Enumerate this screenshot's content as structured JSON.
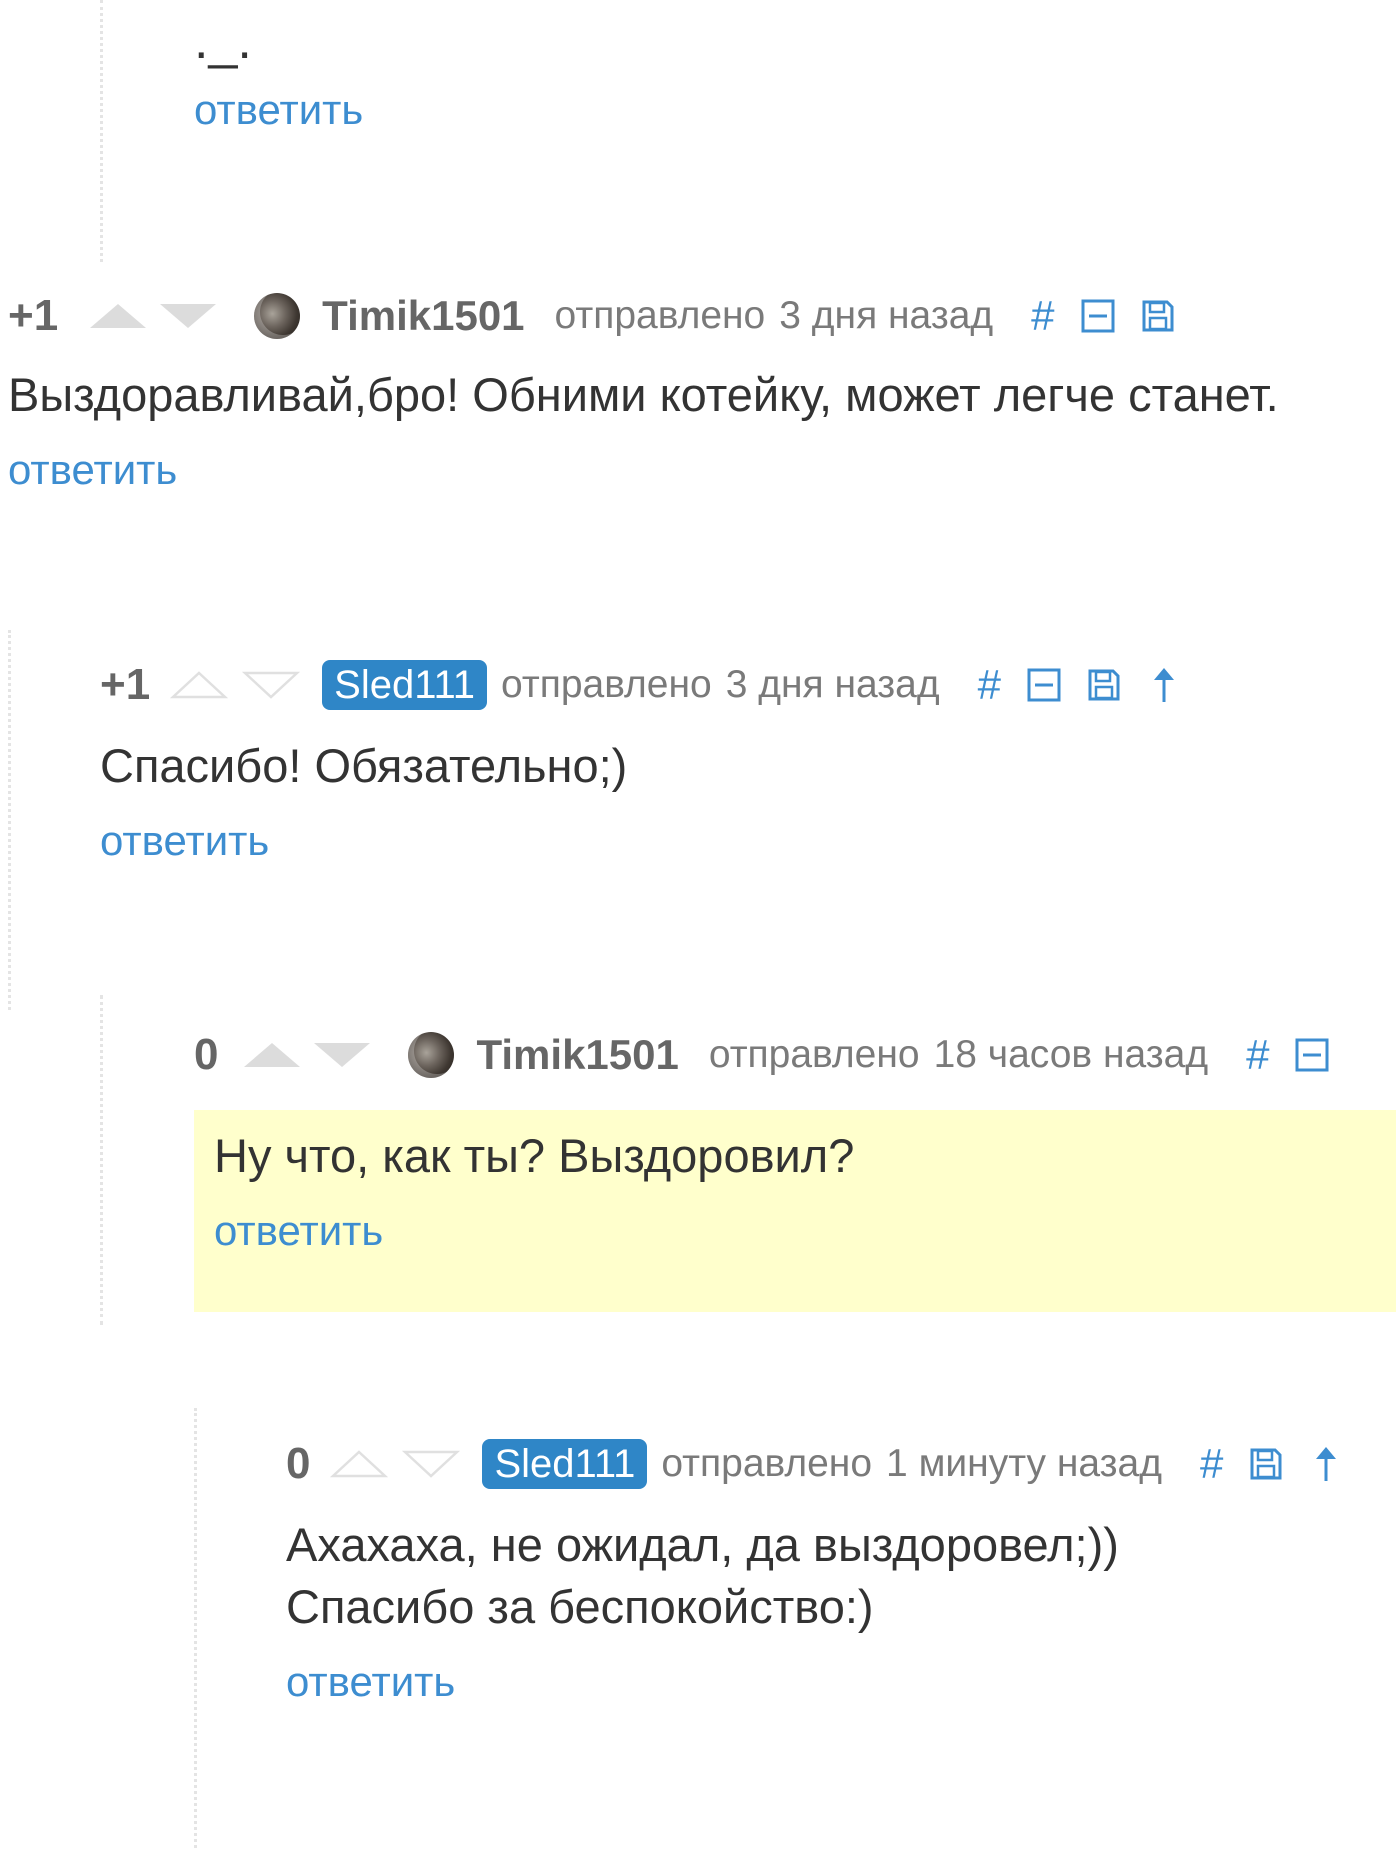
{
  "top_comment": {
    "body": "._.",
    "reply_label": "ответить"
  },
  "comments": [
    {
      "rating": "+1",
      "user": "Timik1501",
      "sent_label": "отправлено",
      "time": "3 дня назад",
      "hash": "#",
      "body": "Выздоравливай,бро! Обними котейку, может легче станет.",
      "reply_label": "ответить"
    },
    {
      "rating": "+1",
      "user": "Sled111",
      "sent_label": "отправлено",
      "time": "3 дня назад",
      "hash": "#",
      "body": "Спасибо! Обязательно;)",
      "reply_label": "ответить"
    },
    {
      "rating": "0",
      "user": "Timik1501",
      "sent_label": "отправлено",
      "time": "18 часов назад",
      "hash": "#",
      "body": "Ну что, как ты? Выздоровил?",
      "reply_label": "ответить"
    },
    {
      "rating": "0",
      "user": "Sled111",
      "sent_label": "отправлено",
      "time": "1 минуту назад",
      "hash": "#",
      "body_line1": "Ахахаха, не ожидал, да выздоровел;))",
      "body_line2": "Спасибо за беспокойство:)",
      "reply_label": "ответить"
    }
  ],
  "colors": {
    "link": "#3d8dd0",
    "badge": "#2f86c7",
    "highlight": "#ffffcc"
  },
  "icons": [
    "up-vote-icon",
    "down-vote-icon",
    "hash-link-icon",
    "collapse-icon",
    "save-icon",
    "parent-arrow-icon"
  ]
}
